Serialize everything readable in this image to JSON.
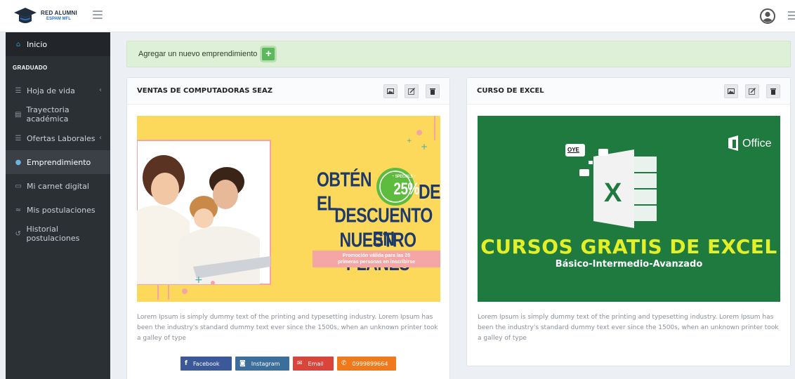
{
  "brand": {
    "name": "RED ALUMNI",
    "sub": "ESPAM MFL"
  },
  "sidebar": {
    "inicio": "Inicio",
    "section": "GRADUADO",
    "items": [
      {
        "label": "Hoja de vida",
        "icon": "list-icon",
        "caret": "‹"
      },
      {
        "label": "Trayectoria académica",
        "icon": "book-icon"
      },
      {
        "label": "Ofertas Laborales",
        "icon": "list-icon",
        "caret": "‹"
      },
      {
        "label": "Emprendimiento",
        "icon": "lightbulb-icon"
      },
      {
        "label": "Mi carnet digital",
        "icon": "id-card-icon"
      },
      {
        "label": "Mis postulaciones",
        "icon": "handshake-icon"
      },
      {
        "label": "Historial postulaciones",
        "icon": "history-icon"
      }
    ]
  },
  "addbar": {
    "label": "Agregar un nuevo emprendimiento",
    "button": "+"
  },
  "cards": [
    {
      "title": "VENTAS DE COMPUTADORAS SEAZ",
      "banner": {
        "line1a": "OBTÉN EL",
        "badge_small": "~ SPECIALS ~",
        "badge_pct": "25%",
        "line1b": "DE",
        "line2": "DESCUENTO EN",
        "line3": "NUESTRO PLANES",
        "promo1": "Promoción válida para las 25",
        "promo2": "primeras personas en inscribirse"
      },
      "description": "Lorem Ipsum is simply dummy text of the printing and typesetting industry. Lorem Ipsum has been the industry's standard dummy text ever since the 1500s, when an unknown printer took a galley of type",
      "social": {
        "facebook": "Facebook",
        "instagram": "Instagram",
        "email": "Email",
        "phone": "0999899664"
      }
    },
    {
      "title": "CURSO DE EXCEL",
      "banner": {
        "office": "Office",
        "oye": "OYE",
        "headline": "CURSOS GRATIS DE EXCEL",
        "subline": "Básico-Intermedio-Avanzado"
      },
      "description": "Lorem Ipsum is simply dummy text of the printing and typesetting industry. Lorem Ipsum has been the industry's standard dummy text ever since the 1500s, when an unknown printer took a galley of type"
    }
  ],
  "colors": {
    "sidebar_bg": "#2b3035",
    "addbar_bg": "#dff0d8",
    "add_button": "#5cb85c",
    "banner1_bg": "#fcd95a",
    "banner2_bg": "#1e7a3f",
    "headline_yellow": "#e3ef27",
    "navy_text": "#1e3a6d"
  }
}
